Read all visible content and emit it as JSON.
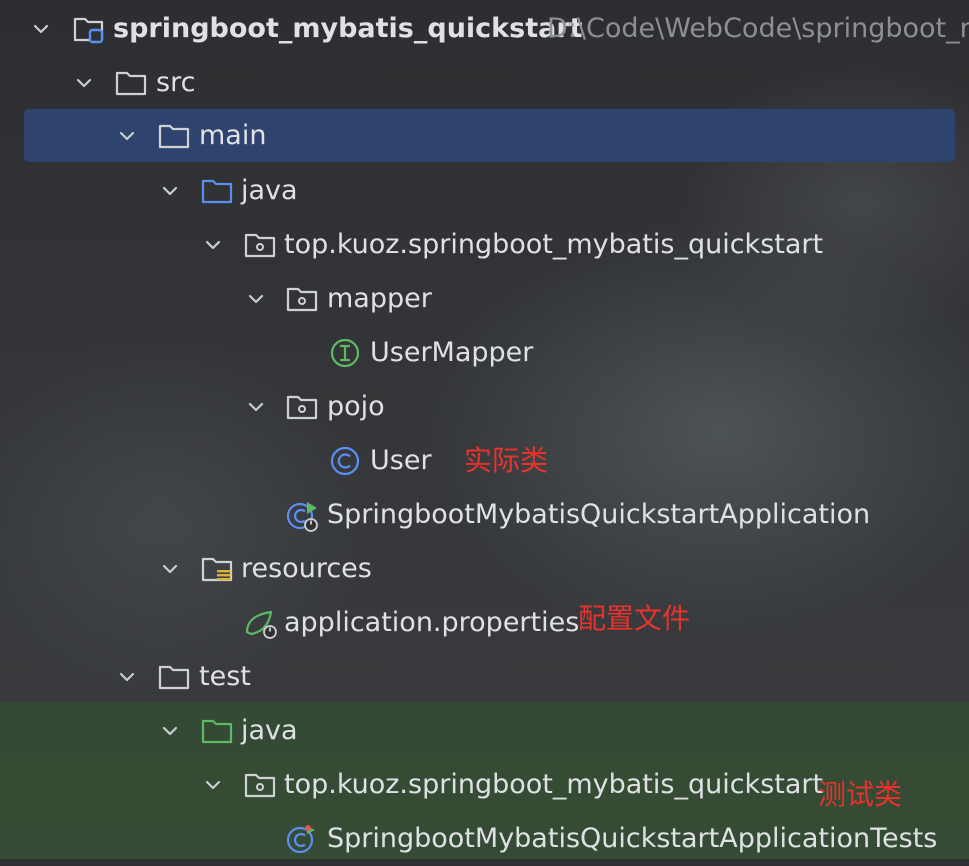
{
  "project": {
    "name": "springboot_mybatis_quickstart",
    "path": "D:\\Code\\WebCode\\springboot_m"
  },
  "tree": {
    "src": "src",
    "main": "main",
    "main_java": "java",
    "main_package": "top.kuoz.springboot_mybatis_quickstart",
    "mapper": "mapper",
    "user_mapper": "UserMapper",
    "pojo": "pojo",
    "user": "User",
    "app_class": "SpringbootMybatisQuickstartApplication",
    "resources": "resources",
    "app_props": "application.properties",
    "test": "test",
    "test_java": "java",
    "test_package": "top.kuoz.springboot_mybatis_quickstart",
    "test_class": "SpringbootMybatisQuickstartApplicationTests"
  },
  "annotations": {
    "entity": "实际类",
    "config": "配置文件",
    "test": "测试类"
  },
  "colors": {
    "selection": "#2e436e",
    "text": "#dfe1e5",
    "path_text": "#8c8f94",
    "annotation": "#e8322c",
    "folder": "#cfd1d5",
    "source_folder": "#5a8ff0",
    "test_folder": "#5fb865",
    "interface_icon": "#5fb865",
    "class_icon": "#5a8ff0",
    "test_highlight": "#345032"
  },
  "icons": {
    "expanded": "chevron-down-icon",
    "module": "module-folder-icon",
    "folder": "folder-icon",
    "source_root": "source-folder-icon",
    "test_root": "test-folder-icon",
    "package": "package-icon",
    "interface": "interface-icon",
    "class": "class-icon",
    "spring_app": "spring-application-icon",
    "resources": "resources-folder-icon",
    "properties": "spring-properties-icon",
    "test_class": "test-class-icon"
  }
}
